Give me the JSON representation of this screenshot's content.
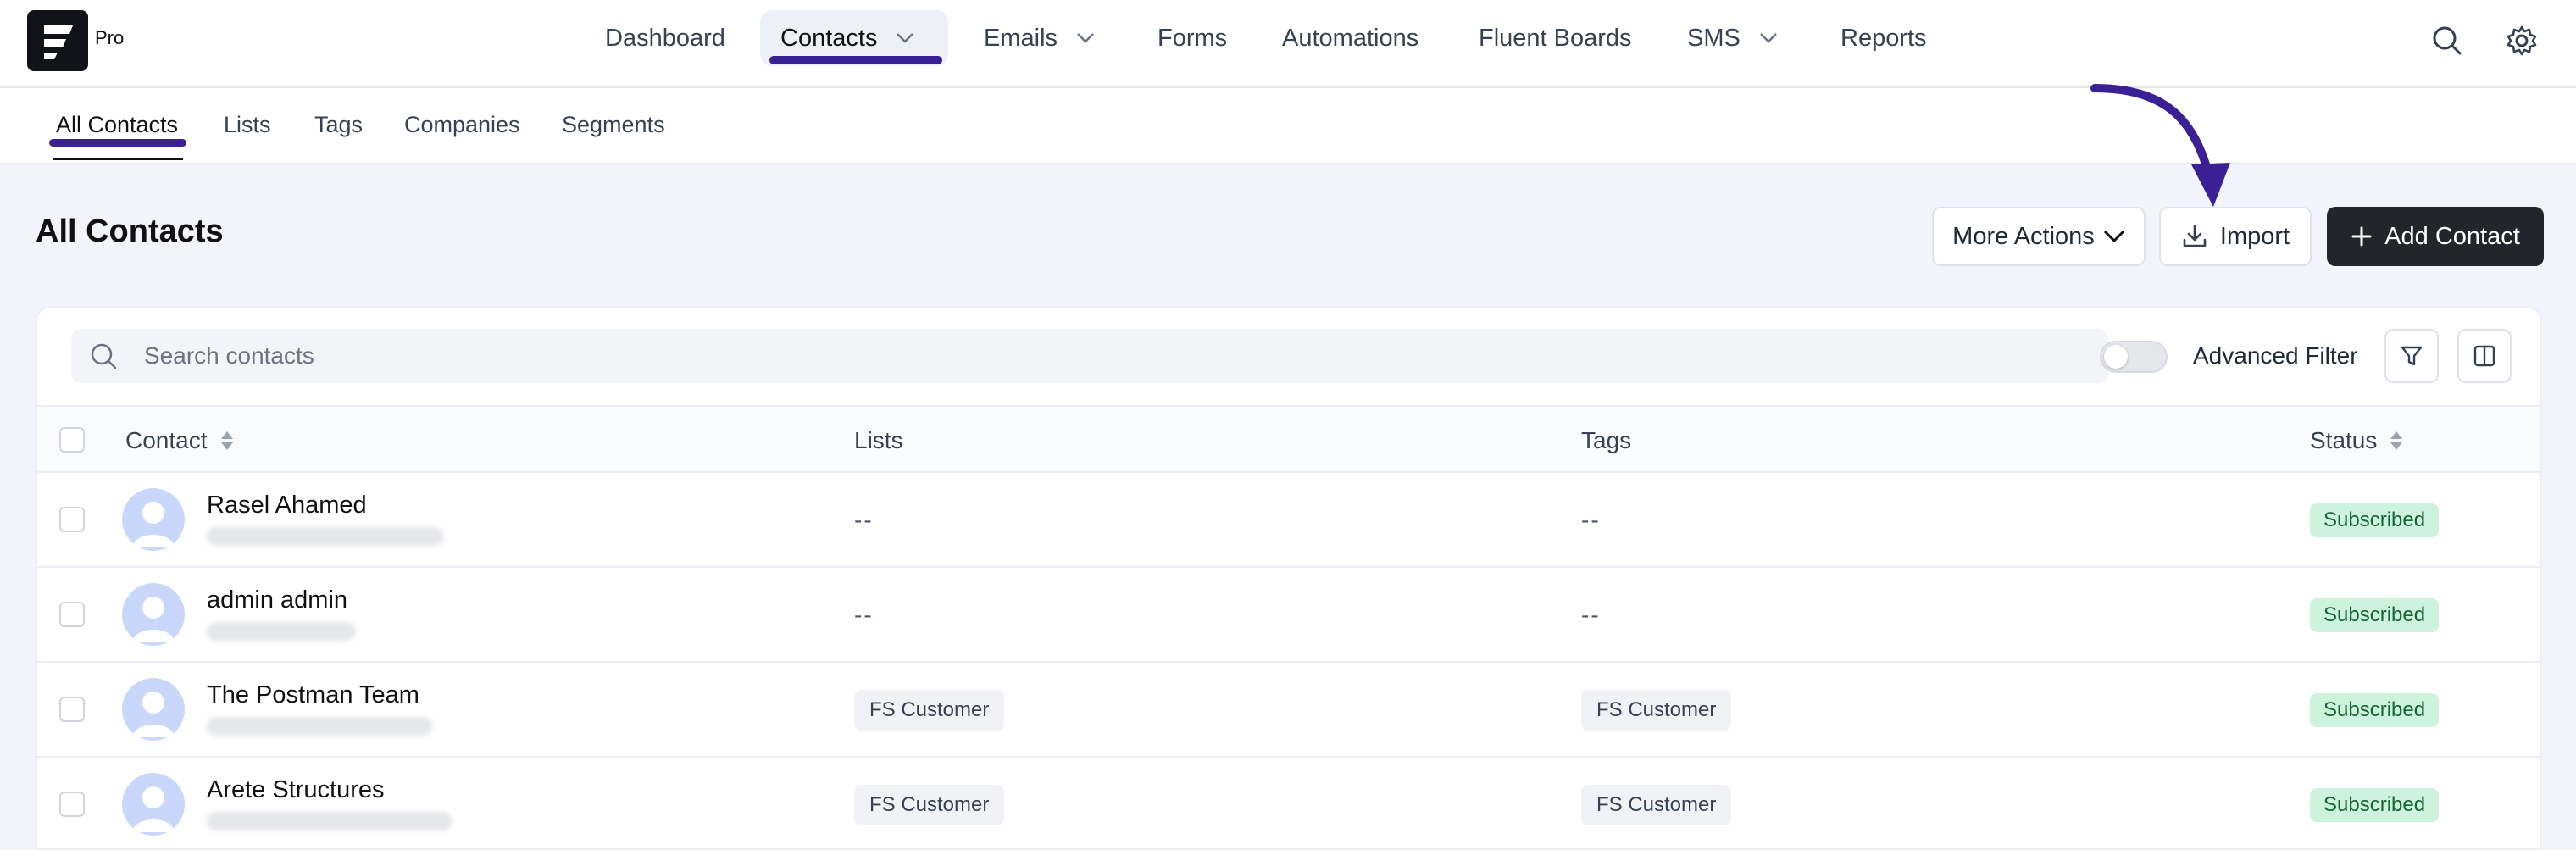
{
  "brand": {
    "edition": "Pro"
  },
  "topnav": {
    "items": [
      {
        "label": "Dashboard"
      },
      {
        "label": "Contacts"
      },
      {
        "label": "Emails"
      },
      {
        "label": "Forms"
      },
      {
        "label": "Automations"
      },
      {
        "label": "Fluent Boards"
      },
      {
        "label": "SMS"
      },
      {
        "label": "Reports"
      }
    ],
    "active": "Contacts"
  },
  "subnav": {
    "tabs": [
      {
        "label": "All Contacts"
      },
      {
        "label": "Lists"
      },
      {
        "label": "Tags"
      },
      {
        "label": "Companies"
      },
      {
        "label": "Segments"
      }
    ],
    "active": "All Contacts"
  },
  "page": {
    "title": "All Contacts",
    "more_actions_label": "More Actions",
    "import_label": "Import",
    "add_contact_label": "Add Contact"
  },
  "toolbar": {
    "search_placeholder": "Search contacts",
    "advanced_filter_label": "Advanced Filter",
    "advanced_filter_enabled": false
  },
  "table": {
    "columns": [
      "Contact",
      "Lists",
      "Tags",
      "Status"
    ],
    "rows": [
      {
        "name": "Rasel Ahamed",
        "lists": "--",
        "tags": "--",
        "status": "Subscribed"
      },
      {
        "name": "admin admin",
        "lists": "--",
        "tags": "--",
        "status": "Subscribed"
      },
      {
        "name": "The Postman Team",
        "lists": "FS Customer",
        "tags": "FS Customer",
        "status": "Subscribed"
      },
      {
        "name": "Arete Structures",
        "lists": "FS Customer",
        "tags": "FS Customer",
        "status": "Subscribed"
      }
    ]
  },
  "colors": {
    "accent": "#3b1f94",
    "primary_button": "#23252d",
    "status_subscribed_bg": "#cdf3df",
    "status_subscribed_text": "#166534"
  }
}
